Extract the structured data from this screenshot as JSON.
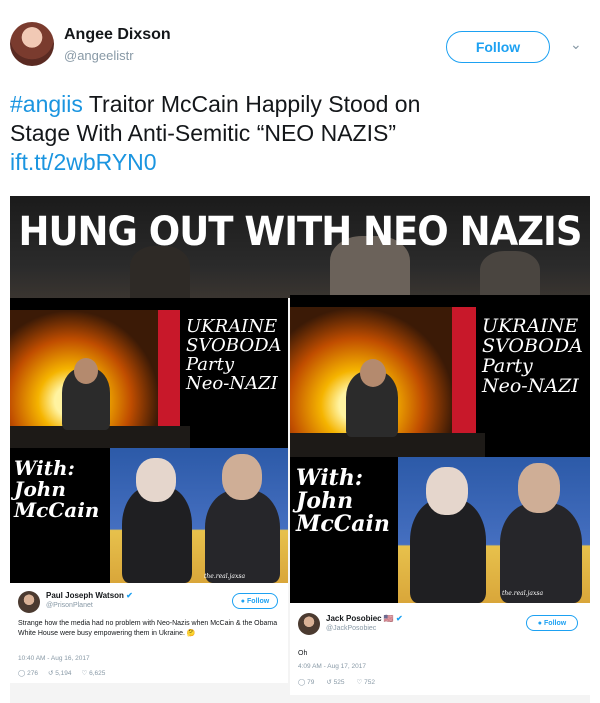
{
  "tweet": {
    "author_name": "Angee Dixson",
    "author_handle": "@angeelistr",
    "follow_label": "Follow",
    "hashtag": "#angiis",
    "text_line1_rest": " Traitor McCain Happily Stood on",
    "text_line2": "Stage With Anti-Semitic “NEO NAZIS”",
    "link": "ift.tt/2wbRYN0"
  },
  "image": {
    "banner": "HUNG OUT WITH NEO NAZIS",
    "left_card": {
      "caption_top": [
        "UKRAINE",
        "SVOBODA",
        "Party",
        "Neo-NAZI"
      ],
      "caption_bottom": [
        "With:",
        "John",
        "McCain"
      ],
      "watermark": "the.real.jaxsa",
      "embedded_tweet": {
        "name": "Paul Joseph Watson",
        "handle": "@PrisonPlanet",
        "follow_label": "Follow",
        "body": "Strange how the media had no problem with Neo-Nazis when McCain & the Obama White House were busy empowering them in Ukraine. 🤔",
        "timestamp": "10:40 AM - Aug 16, 2017",
        "replies": "276",
        "retweets": "5,194",
        "likes": "6,625"
      }
    },
    "right_card": {
      "caption_top": [
        "UKRAINE",
        "SVOBODA",
        "Party",
        "Neo-NAZI"
      ],
      "caption_bottom": [
        "With:",
        "John",
        "McCain"
      ],
      "watermark": "the.real.jaxsa",
      "embedded_tweet": {
        "name": "Jack Posobiec",
        "flag": "🇺🇸",
        "handle": "@JackPosobiec",
        "follow_label": "Follow",
        "body": "Oh",
        "timestamp": "4:09 AM - Aug 17, 2017",
        "replies": "79",
        "retweets": "525",
        "likes": "752"
      }
    }
  },
  "colors": {
    "accent": "#1da1f2",
    "link": "#1b95e0",
    "muted": "#8899a6"
  }
}
